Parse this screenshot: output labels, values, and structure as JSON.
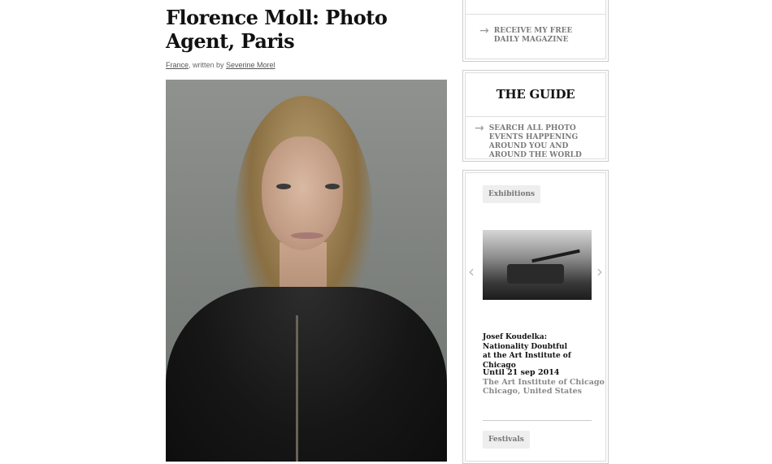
{
  "article": {
    "title": "Florence Moll: Photo Agent, Paris",
    "byline_country": "France",
    "byline_mid": ", written by ",
    "byline_author": "Severine Morel"
  },
  "sidebar": {
    "magazine_link": "RECEIVE MY FREE DAILY MAGAZINE",
    "guide_title": "THE GUIDE",
    "guide_link": "SEARCH ALL PHOTO EVENTS HAPPENING AROUND YOU AND AROUND THE WORLD",
    "exhibitions_tag": "Exhibitions",
    "exhibition": {
      "title_line1": "Josef Koudelka: Nationality Doubtful",
      "title_line2": "at the Art Institute of Chicago",
      "date": "Until 21 sep 2014",
      "venue": "The Art Institute of Chicago",
      "location": "Chicago, United States"
    },
    "festivals_tag": "Festivals"
  },
  "icons": {
    "arrow": "→",
    "prev": "‹",
    "next": "›"
  }
}
